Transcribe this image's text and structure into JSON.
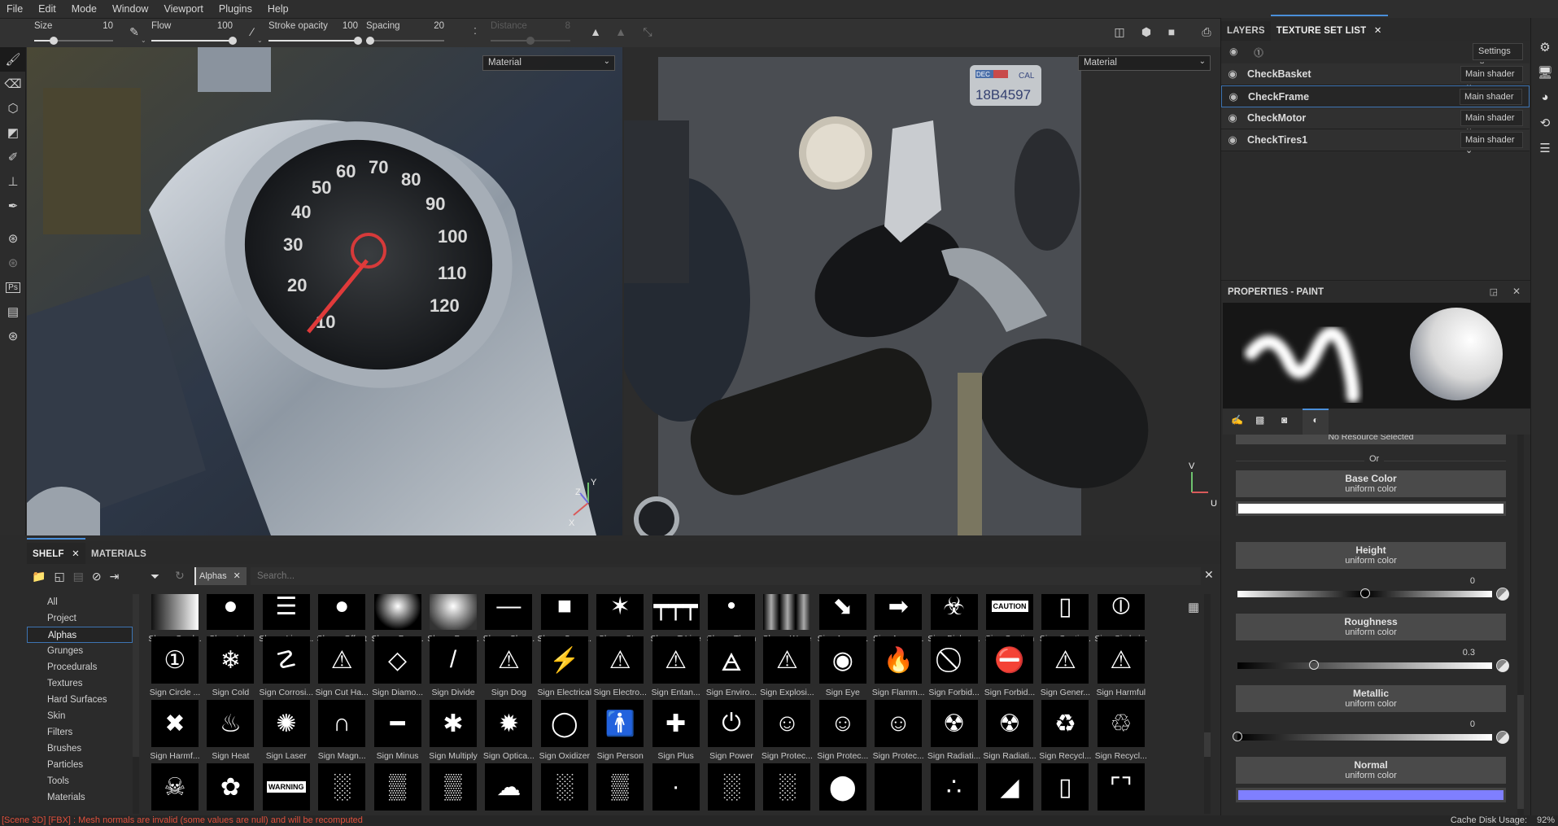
{
  "menu": [
    "File",
    "Edit",
    "Mode",
    "Window",
    "Viewport",
    "Plugins",
    "Help"
  ],
  "toolbar": {
    "size": {
      "label": "Size",
      "value": "10",
      "fraction": 0.25
    },
    "flow": {
      "label": "Flow",
      "value": "100",
      "fraction": 1.0
    },
    "stroke_opacity": {
      "label": "Stroke opacity",
      "value": "100",
      "fraction": 1.0
    },
    "spacing": {
      "label": "Spacing",
      "value": "20",
      "fraction": 0.05
    },
    "distance": {
      "label": "Distance",
      "value": "8",
      "fraction": 0.5,
      "disabled": true
    }
  },
  "viewports": {
    "left_mode": "Material",
    "right_mode": "Material",
    "gizmo_3d": [
      "X",
      "Y",
      "Z"
    ],
    "gizmo_uv": [
      "U",
      "V"
    ],
    "plate": {
      "month": "DEC",
      "state": "CAL",
      "number": "18B4597"
    },
    "speedo_ticks": [
      "10",
      "20",
      "30",
      "40",
      "50",
      "60",
      "70",
      "80",
      "90",
      "100",
      "110",
      "120"
    ]
  },
  "right_panel": {
    "tabs": [
      {
        "label": "LAYERS"
      },
      {
        "label": "TEXTURE SET LIST",
        "active": true
      }
    ],
    "settings_label": "Settings",
    "texture_sets": [
      {
        "name": "CheckBasket",
        "shader": "Main shader"
      },
      {
        "name": "CheckFrame",
        "shader": "Main shader",
        "selected": true
      },
      {
        "name": "CheckMotor",
        "shader": "Main shader"
      },
      {
        "name": "CheckTires1",
        "shader": "Main shader"
      }
    ],
    "properties_title": "PROPERTIES - PAINT",
    "no_resource": "No Resource Selected",
    "or_label": "Or",
    "channels": [
      {
        "name": "Base Color",
        "sub": "uniform color",
        "type": "color",
        "color": "#ffffff"
      },
      {
        "name": "Height",
        "sub": "uniform color",
        "type": "slider",
        "value": "0",
        "fraction": 0.5
      },
      {
        "name": "Roughness",
        "sub": "uniform color",
        "type": "slider",
        "value": "0.3",
        "fraction": 0.3
      },
      {
        "name": "Metallic",
        "sub": "uniform color",
        "type": "slider",
        "value": "0",
        "fraction": 0.0
      },
      {
        "name": "Normal",
        "sub": "uniform color",
        "type": "color",
        "color": "#7f7fff"
      }
    ]
  },
  "shelf": {
    "tabs": [
      {
        "label": "SHELF",
        "active": true
      },
      {
        "label": "MATERIALS"
      }
    ],
    "filter_chip": "Alphas",
    "search_placeholder": "Search...",
    "categories": [
      "All",
      "Project",
      "Alphas",
      "Grunges",
      "Procedurals",
      "Textures",
      "Hard Surfaces",
      "Skin",
      "Filters",
      "Brushes",
      "Particles",
      "Tools",
      "Materials"
    ],
    "selected_category": "Alphas",
    "rows": [
      [
        {
          "n": "Shape Grad...",
          "g": "grad"
        },
        {
          "n": "Shape Inky",
          "g": "●"
        },
        {
          "n": "Shape Lines...",
          "g": "☰"
        },
        {
          "n": "Shape Offset",
          "g": "●"
        },
        {
          "n": "Shape Para...",
          "g": "glow"
        },
        {
          "n": "Shape Pyra...",
          "g": "pyr"
        },
        {
          "n": "Shape Shar...",
          "g": "—"
        },
        {
          "n": "Shape Squa...",
          "g": "■"
        },
        {
          "n": "Shape Star",
          "g": "✶"
        },
        {
          "n": "Shape T Line",
          "g": "┯┯┯"
        },
        {
          "n": "Shape Thorn",
          "g": "•"
        },
        {
          "n": "Shape Wave",
          "g": "wave"
        },
        {
          "n": "Sign Arrow ...",
          "g": "⬊"
        },
        {
          "n": "Sign Arrow ...",
          "g": "➡"
        },
        {
          "n": "Sign Biohaz...",
          "g": "☣"
        },
        {
          "n": "Sign Caution",
          "g": "CAUTION"
        },
        {
          "n": "Sign Cautio...",
          "g": "▯"
        },
        {
          "n": "Sign Circle i...",
          "g": "⦶"
        }
      ],
      [
        {
          "n": "Sign Circle ...",
          "g": "①"
        },
        {
          "n": "Sign Cold",
          "g": "❄"
        },
        {
          "n": "Sign Corrosi...",
          "g": "☡"
        },
        {
          "n": "Sign Cut Ha...",
          "g": "⚠"
        },
        {
          "n": "Sign Diamo...",
          "g": "◇"
        },
        {
          "n": "Sign Divide",
          "g": "/"
        },
        {
          "n": "Sign Dog",
          "g": "⚠"
        },
        {
          "n": "Sign Electrical",
          "g": "⚡"
        },
        {
          "n": "Sign Electro...",
          "g": "⚠"
        },
        {
          "n": "Sign Entan...",
          "g": "⚠"
        },
        {
          "n": "Sign Enviro...",
          "g": "🜁"
        },
        {
          "n": "Sign Explosi...",
          "g": "⚠"
        },
        {
          "n": "Sign Eye",
          "g": "◉"
        },
        {
          "n": "Sign Flamm...",
          "g": "🔥"
        },
        {
          "n": "Sign Forbid...",
          "g": "⃠"
        },
        {
          "n": "Sign Forbid...",
          "g": "⛔"
        },
        {
          "n": "Sign Gener...",
          "g": "⚠"
        },
        {
          "n": "Sign Harmful",
          "g": "⚠"
        }
      ],
      [
        {
          "n": "Sign Harmf...",
          "g": "✖"
        },
        {
          "n": "Sign Heat",
          "g": "♨"
        },
        {
          "n": "Sign Laser",
          "g": "✺"
        },
        {
          "n": "Sign Magn...",
          "g": "∩"
        },
        {
          "n": "Sign Minus",
          "g": "━"
        },
        {
          "n": "Sign Multiply",
          "g": "✱"
        },
        {
          "n": "Sign Optica...",
          "g": "✹"
        },
        {
          "n": "Sign Oxidizer",
          "g": "◯"
        },
        {
          "n": "Sign Person",
          "g": "🚹"
        },
        {
          "n": "Sign Plus",
          "g": "✚"
        },
        {
          "n": "Sign Power",
          "g": "⏻"
        },
        {
          "n": "Sign Protec...",
          "g": "☺"
        },
        {
          "n": "Sign Protec...",
          "g": "☺"
        },
        {
          "n": "Sign Protec...",
          "g": "☺"
        },
        {
          "n": "Sign Radiati...",
          "g": "☢"
        },
        {
          "n": "Sign Radiati...",
          "g": "☢"
        },
        {
          "n": "Sign Recycl...",
          "g": "♻"
        },
        {
          "n": "Sign Recycl...",
          "g": "♲"
        }
      ],
      [
        {
          "n": "",
          "g": "☠"
        },
        {
          "n": "",
          "g": "✿"
        },
        {
          "n": "",
          "g": "WARNING"
        },
        {
          "n": "",
          "g": "░"
        },
        {
          "n": "",
          "g": "▒"
        },
        {
          "n": "",
          "g": "▒"
        },
        {
          "n": "",
          "g": "☁"
        },
        {
          "n": "",
          "g": "░"
        },
        {
          "n": "",
          "g": "▒"
        },
        {
          "n": "",
          "g": "·"
        },
        {
          "n": "",
          "g": "░"
        },
        {
          "n": "",
          "g": "░"
        },
        {
          "n": "",
          "g": "⬤"
        },
        {
          "n": "",
          "g": ""
        },
        {
          "n": "",
          "g": "∴"
        },
        {
          "n": "",
          "g": "◢"
        },
        {
          "n": "",
          "g": "▯"
        },
        {
          "n": "",
          "g": "⌜⌝"
        }
      ]
    ]
  },
  "status": {
    "message": "[Scene 3D] [FBX] : Mesh normals are invalid (some values are null) and will be recomputed",
    "cache_label": "Cache Disk Usage:",
    "cache_value": "92%"
  },
  "colors": {
    "accent": "#4a8fd9",
    "error": "#e0503c",
    "normal": "#7f7fff"
  }
}
